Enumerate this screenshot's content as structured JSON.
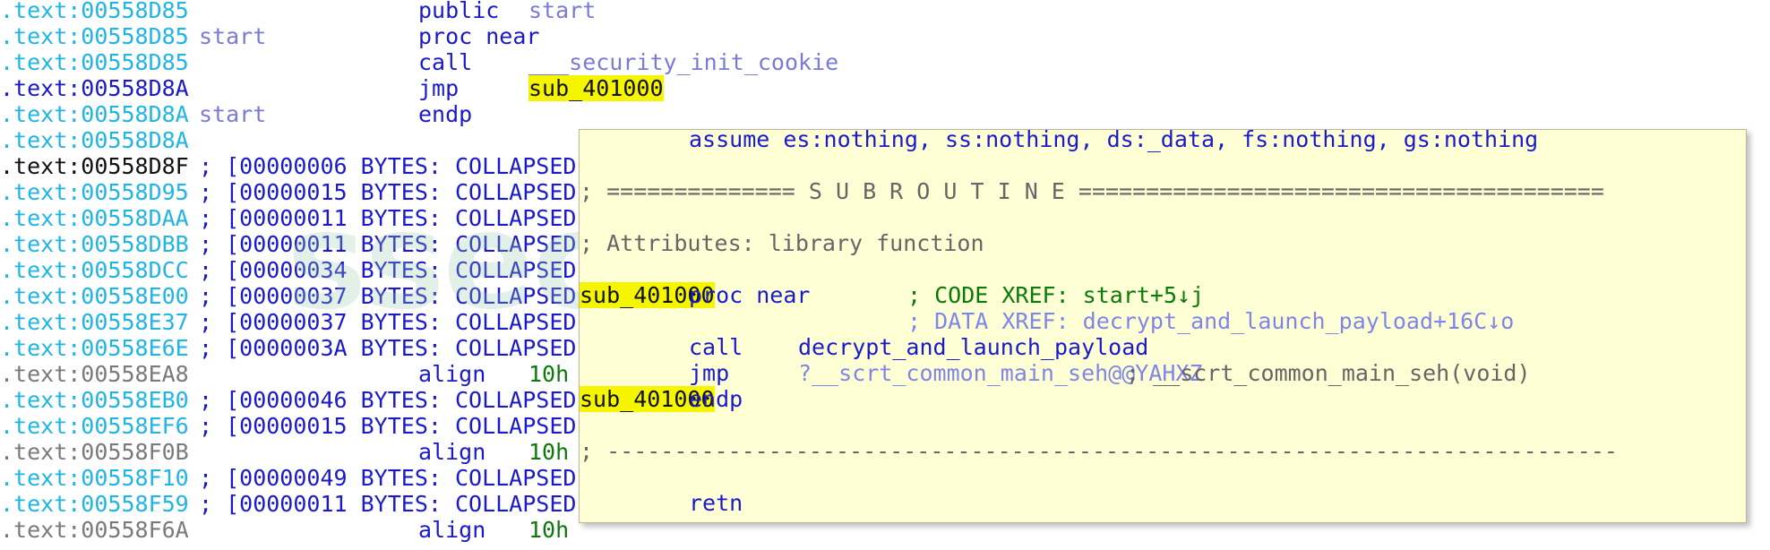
{
  "watermark": "ssecurity",
  "listing": [
    {
      "addr": ".text:00558D85",
      "addr_color": "cyan",
      "label": "",
      "instr": "public",
      "instr_color": "navy",
      "oper": "start",
      "oper_color": "label",
      "comment": ""
    },
    {
      "addr": ".text:00558D85",
      "addr_color": "cyan",
      "label": "start",
      "instr": "proc near",
      "instr_color": "navy",
      "oper": "",
      "oper_color": "",
      "comment": ""
    },
    {
      "addr": ".text:00558D85",
      "addr_color": "cyan",
      "label": "",
      "instr": "call",
      "instr_color": "navy",
      "oper": "___security_init_cookie",
      "oper_color": "label",
      "comment": ""
    },
    {
      "addr": ".text:00558D8A",
      "addr_color": "navy",
      "label": "",
      "instr": "jmp",
      "instr_color": "navy",
      "oper": "sub_401000",
      "oper_color": "hl",
      "comment": ""
    },
    {
      "addr": ".text:00558D8A",
      "addr_color": "cyan",
      "label": "start",
      "instr": "endp",
      "instr_color": "navy",
      "oper": "",
      "oper_color": "",
      "comment": ""
    },
    {
      "addr": ".text:00558D8A",
      "addr_color": "cyan",
      "label": "",
      "instr": "",
      "instr_color": "",
      "oper": "",
      "oper_color": "",
      "comment": ""
    },
    {
      "addr": ".text:00558D8F",
      "addr_color": "black",
      "label": "",
      "instr": "",
      "instr_color": "",
      "oper": "",
      "oper_color": "",
      "comment": "; [00000006 BYTES: COLLAPSED"
    },
    {
      "addr": ".text:00558D95",
      "addr_color": "cyan",
      "label": "",
      "instr": "",
      "instr_color": "",
      "oper": "",
      "oper_color": "",
      "comment": "; [00000015 BYTES: COLLAPSED"
    },
    {
      "addr": ".text:00558DAA",
      "addr_color": "cyan",
      "label": "",
      "instr": "",
      "instr_color": "",
      "oper": "",
      "oper_color": "",
      "comment": "; [00000011 BYTES: COLLAPSED"
    },
    {
      "addr": ".text:00558DBB",
      "addr_color": "cyan",
      "label": "",
      "instr": "",
      "instr_color": "",
      "oper": "",
      "oper_color": "",
      "comment": "; [00000011 BYTES: COLLAPSED"
    },
    {
      "addr": ".text:00558DCC",
      "addr_color": "cyan",
      "label": "",
      "instr": "",
      "instr_color": "",
      "oper": "",
      "oper_color": "",
      "comment": "; [00000034 BYTES: COLLAPSED"
    },
    {
      "addr": ".text:00558E00",
      "addr_color": "cyan",
      "label": "",
      "instr": "",
      "instr_color": "",
      "oper": "",
      "oper_color": "",
      "comment": "; [00000037 BYTES: COLLAPSED"
    },
    {
      "addr": ".text:00558E37",
      "addr_color": "cyan",
      "label": "",
      "instr": "",
      "instr_color": "",
      "oper": "",
      "oper_color": "",
      "comment": "; [00000037 BYTES: COLLAPSED"
    },
    {
      "addr": ".text:00558E6E",
      "addr_color": "cyan",
      "label": "",
      "instr": "",
      "instr_color": "",
      "oper": "",
      "oper_color": "",
      "comment": "; [0000003A BYTES: COLLAPSED"
    },
    {
      "addr": ".text:00558EA8",
      "addr_color": "gray",
      "label": "",
      "instr": "align",
      "instr_color": "navy",
      "oper": "10h",
      "oper_color": "green",
      "comment": ""
    },
    {
      "addr": ".text:00558EB0",
      "addr_color": "cyan",
      "label": "",
      "instr": "",
      "instr_color": "",
      "oper": "",
      "oper_color": "",
      "comment": "; [00000046 BYTES: COLLAPSED"
    },
    {
      "addr": ".text:00558EF6",
      "addr_color": "cyan",
      "label": "",
      "instr": "",
      "instr_color": "",
      "oper": "",
      "oper_color": "",
      "comment": "; [00000015 BYTES: COLLAPSED"
    },
    {
      "addr": ".text:00558F0B",
      "addr_color": "gray",
      "label": "",
      "instr": "align",
      "instr_color": "navy",
      "oper": "10h",
      "oper_color": "green",
      "comment": ""
    },
    {
      "addr": ".text:00558F10",
      "addr_color": "cyan",
      "label": "",
      "instr": "",
      "instr_color": "",
      "oper": "",
      "oper_color": "",
      "comment": "; [00000049 BYTES: COLLAPSED"
    },
    {
      "addr": ".text:00558F59",
      "addr_color": "cyan",
      "label": "",
      "instr": "",
      "instr_color": "",
      "oper": "",
      "oper_color": "",
      "comment": "; [00000011 BYTES: COLLAPSED"
    },
    {
      "addr": ".text:00558F6A",
      "addr_color": "gray",
      "label": "",
      "instr": "align",
      "instr_color": "navy",
      "oper": "10h",
      "oper_color": "green",
      "comment": ""
    }
  ],
  "popup": {
    "lines": [
      {
        "segments": [
          {
            "text": "assume es:nothing, ss:nothing, ds:_data, fs:nothing, gs:nothing",
            "color": "navy",
            "col": 4
          }
        ]
      },
      {
        "segments": []
      },
      {
        "segments": [
          {
            "text": "; ============== S U B R O U T I N E =======================================",
            "color": "dgray",
            "col": 0
          }
        ]
      },
      {
        "segments": []
      },
      {
        "segments": [
          {
            "text": "; Attributes: library function",
            "color": "dgray",
            "col": 0
          }
        ]
      },
      {
        "segments": []
      },
      {
        "segments": [
          {
            "text": "sub_401000",
            "color": "hl",
            "col": 0
          },
          {
            "text": "proc near",
            "color": "navy",
            "col": 4
          },
          {
            "text": "; CODE XREF: start+5↓j",
            "color": "green",
            "col": 12
          }
        ]
      },
      {
        "segments": [
          {
            "text": "; DATA XREF: decrypt_and_launch_payload+16C↓o",
            "color": "lblue",
            "col": 12
          }
        ]
      },
      {
        "segments": [
          {
            "text": "call",
            "color": "navy",
            "col": 4
          },
          {
            "text": "decrypt_and_launch_payload",
            "color": "navy",
            "col": 8
          }
        ]
      },
      {
        "segments": [
          {
            "text": "jmp",
            "color": "navy",
            "col": 4
          },
          {
            "text": "?__scrt_common_main_seh@@YAHXZ",
            "color": "lblue",
            "col": 8
          },
          {
            "text": "; __scrt_common_main_seh(void)",
            "color": "dgray",
            "col": 20
          }
        ]
      },
      {
        "segments": [
          {
            "text": "sub_401000",
            "color": "hl",
            "col": 0
          },
          {
            "text": "endp",
            "color": "navy",
            "col": 4
          }
        ]
      },
      {
        "segments": []
      },
      {
        "segments": [
          {
            "text": "; ---------------------------------------------------------------------------",
            "color": "dgray",
            "col": 0
          }
        ]
      },
      {
        "segments": []
      },
      {
        "segments": [
          {
            "text": "retn",
            "color": "navy",
            "col": 4
          }
        ]
      }
    ]
  }
}
